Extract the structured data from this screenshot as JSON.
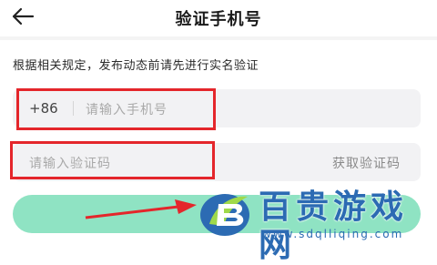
{
  "header": {
    "title": "验证手机号"
  },
  "notice": "根据相关规定，发布动态前请先进行实名验证",
  "phone": {
    "prefix": "+86",
    "placeholder": "请输入手机号"
  },
  "code": {
    "placeholder": "请输入验证码",
    "get_code_label": "获取验证码"
  },
  "watermark": {
    "text": "百贵游戏网",
    "url": "www.sdqlliqing.com"
  },
  "colors": {
    "submit_button": "#8fe3c3",
    "annotation_red": "#e4262b",
    "watermark_blue": "#2c6bb3",
    "field_bg": "#f2f2f4"
  },
  "icons": {
    "back": "arrow-left-icon"
  }
}
